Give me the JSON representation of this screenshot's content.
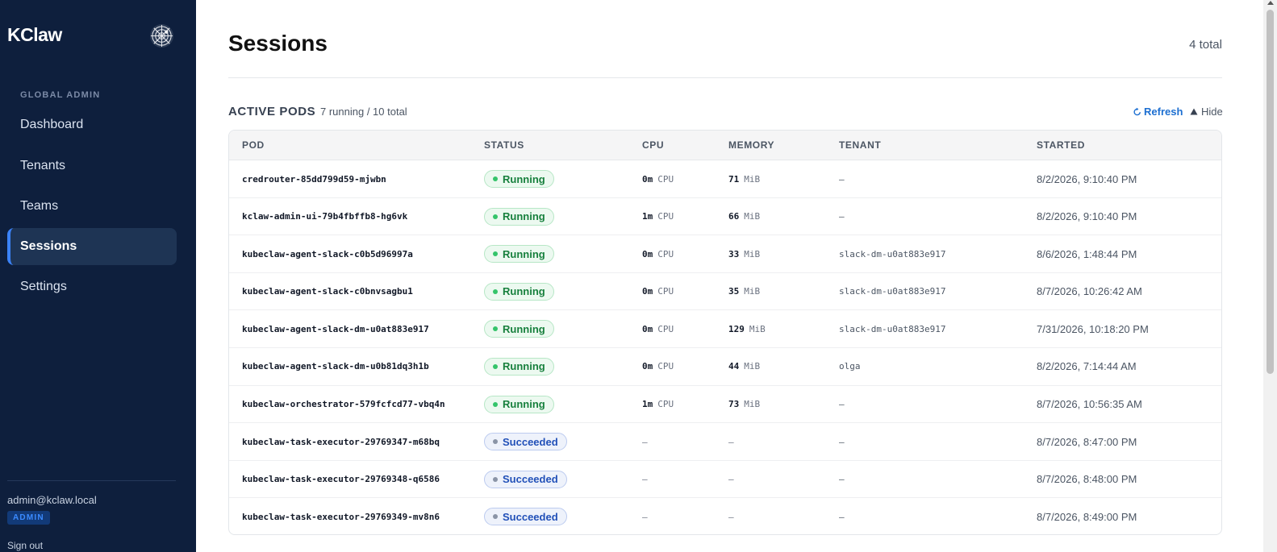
{
  "sidebar": {
    "brand": "KClaw",
    "logo_icon": "spiderweb-logo-icon",
    "section_label": "GLOBAL ADMIN",
    "items": [
      {
        "label": "Dashboard",
        "active": false
      },
      {
        "label": "Tenants",
        "active": false
      },
      {
        "label": "Teams",
        "active": false
      },
      {
        "label": "Sessions",
        "active": true
      },
      {
        "label": "Settings",
        "active": false
      }
    ],
    "user_email": "admin@kclaw.local",
    "role_badge": "ADMIN",
    "signout_label": "Sign out"
  },
  "header": {
    "title": "Sessions",
    "total": "4 total"
  },
  "pods": {
    "title": "ACTIVE PODS",
    "summary": "7 running / 10 total",
    "refresh_label": "Refresh",
    "hide_label": "Hide",
    "columns": [
      "POD",
      "STATUS",
      "CPU",
      "MEMORY",
      "TENANT",
      "STARTED"
    ],
    "cpu_unit": "CPU",
    "mem_unit": "MiB",
    "rows": [
      {
        "pod": "credrouter-85dd799d59-mjwbn",
        "status": "Running",
        "cpu": "0m",
        "mem": "71",
        "tenant": "–",
        "started": "8/2/2026, 9:10:40 PM"
      },
      {
        "pod": "kclaw-admin-ui-79b4fbffb8-hg6vk",
        "status": "Running",
        "cpu": "1m",
        "mem": "66",
        "tenant": "–",
        "started": "8/2/2026, 9:10:40 PM"
      },
      {
        "pod": "kubeclaw-agent-slack-c0b5d96997a",
        "status": "Running",
        "cpu": "0m",
        "mem": "33",
        "tenant": "slack-dm-u0at883e917",
        "started": "8/6/2026, 1:48:44 PM"
      },
      {
        "pod": "kubeclaw-agent-slack-c0bnvsagbu1",
        "status": "Running",
        "cpu": "0m",
        "mem": "35",
        "tenant": "slack-dm-u0at883e917",
        "started": "8/7/2026, 10:26:42 AM"
      },
      {
        "pod": "kubeclaw-agent-slack-dm-u0at883e917",
        "status": "Running",
        "cpu": "0m",
        "mem": "129",
        "tenant": "slack-dm-u0at883e917",
        "started": "7/31/2026, 10:18:20 PM"
      },
      {
        "pod": "kubeclaw-agent-slack-dm-u0b81dq3h1b",
        "status": "Running",
        "cpu": "0m",
        "mem": "44",
        "tenant": "olga",
        "started": "8/2/2026, 7:14:44 AM"
      },
      {
        "pod": "kubeclaw-orchestrator-579fcfcd77-vbq4n",
        "status": "Running",
        "cpu": "1m",
        "mem": "73",
        "tenant": "–",
        "started": "8/7/2026, 10:56:35 AM"
      },
      {
        "pod": "kubeclaw-task-executor-29769347-m68bq",
        "status": "Succeeded",
        "cpu": "—",
        "mem": "—",
        "tenant": "–",
        "started": "8/7/2026, 8:47:00 PM"
      },
      {
        "pod": "kubeclaw-task-executor-29769348-q6586",
        "status": "Succeeded",
        "cpu": "—",
        "mem": "—",
        "tenant": "–",
        "started": "8/7/2026, 8:48:00 PM"
      },
      {
        "pod": "kubeclaw-task-executor-29769349-mv8n6",
        "status": "Succeeded",
        "cpu": "—",
        "mem": "—",
        "tenant": "–",
        "started": "8/7/2026, 8:49:00 PM"
      }
    ]
  },
  "colors": {
    "sidebar_bg": "#0e1f3d",
    "accent": "#1d6fd1",
    "running": "#17803d",
    "succeeded": "#2150b8"
  }
}
